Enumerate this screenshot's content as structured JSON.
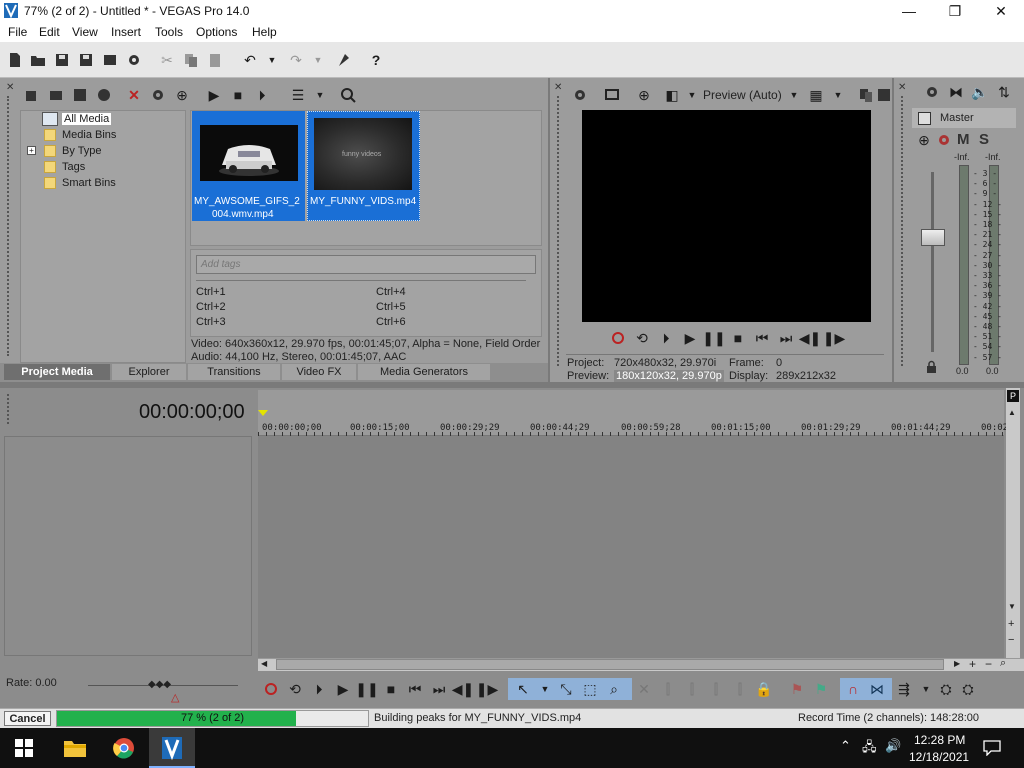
{
  "window": {
    "title": "77% (2 of 2) - Untitled * - VEGAS Pro 14.0",
    "controls": {
      "minimize": "—",
      "maximize": "❐",
      "close": "✕"
    }
  },
  "menu": [
    "File",
    "Edit",
    "View",
    "Insert",
    "Tools",
    "Options",
    "Help"
  ],
  "project_media": {
    "tree": [
      "All Media",
      "Media Bins",
      "By Type",
      "Tags",
      "Smart Bins"
    ],
    "tree_expand": "+",
    "media": [
      {
        "name_line1": "MY_AWSOME_GIFS_2",
        "name_line2": "004.wmv.mp4"
      },
      {
        "name_line1": "MY_FUNNY_VIDS.mp4",
        "name_line2": "",
        "thumb_text": "funny videos"
      }
    ],
    "tags_placeholder": "Add tags",
    "shortcuts": [
      "Ctrl+1",
      "Ctrl+2",
      "Ctrl+3",
      "Ctrl+4",
      "Ctrl+5",
      "Ctrl+6"
    ],
    "info_video": "Video: 640x360x12, 29.970 fps, 00:01:45;07, Alpha = None, Field Order",
    "info_audio": "Audio: 44,100 Hz, Stereo, 00:01:45;07, AAC"
  },
  "tabs": [
    "Project Media",
    "Explorer",
    "Transitions",
    "Video FX",
    "Media Generators"
  ],
  "preview": {
    "mode": "Preview (Auto)",
    "project_label": "Project:",
    "project_value": "720x480x32, 29.970i",
    "preview_label": "Preview:",
    "preview_value": "180x120x32, 29.970p",
    "frame_label": "Frame:",
    "frame_value": "0",
    "display_label": "Display:",
    "display_value": "289x212x32"
  },
  "master": {
    "title": "Master",
    "mute": "M",
    "solo": "S",
    "peak_left": "-Inf.",
    "peak_right": "-Inf.",
    "scale": [
      "3",
      "6",
      "9",
      "12",
      "15",
      "18",
      "21",
      "24",
      "27",
      "30",
      "33",
      "36",
      "39",
      "42",
      "45",
      "48",
      "51",
      "54",
      "57"
    ],
    "level_left": "0.0",
    "level_right": "0.0"
  },
  "timeline": {
    "timecode": "00:00:00;00",
    "ruler": [
      "00:00:00;00",
      "00:00:15;00",
      "00:00:29;29",
      "00:00:44;29",
      "00:00:59;28",
      "00:01:15;00",
      "00:01:29;29",
      "00:01:44;29",
      "00:02:"
    ],
    "rate": "Rate: 0.00"
  },
  "status": {
    "cancel": "Cancel",
    "progress_text": "77 % (2 of 2)",
    "progress": 0.77,
    "message": "Building peaks for MY_FUNNY_VIDS.mp4",
    "record_time": "Record Time (2 channels): 148:28:00"
  },
  "taskbar": {
    "time": "12:28 PM",
    "date": "12/18/2021"
  },
  "colors": {
    "accent": "#1a6fd6",
    "progress": "#22b14c",
    "panel": "#9c9c9c",
    "timeline": "#7d7d7d"
  }
}
